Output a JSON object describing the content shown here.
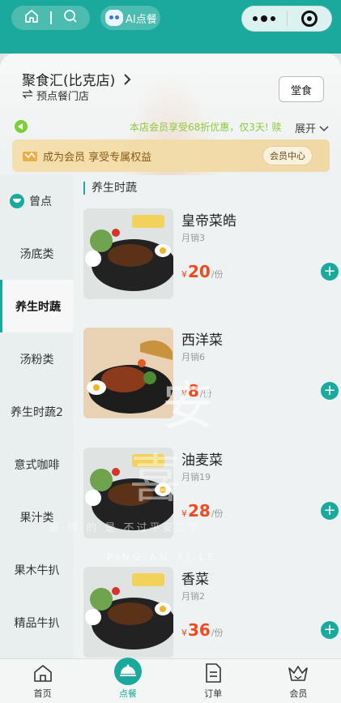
{
  "header": {
    "ai_label": "AI点餐"
  },
  "shop": {
    "name": "聚食汇(比克店)",
    "switch_label": "预点餐门店",
    "dine_label": "堂食",
    "notice": "本店会员享受68折优惠，仅3天! 赎",
    "expand_label": "展开",
    "member_text": "成为会员 享受专属权益",
    "member_button": "会员中心"
  },
  "sidebar": {
    "items": [
      {
        "label": "曾点"
      },
      {
        "label": "汤底类"
      },
      {
        "label": "养生时蔬"
      },
      {
        "label": "汤粉类"
      },
      {
        "label": "养生时蔬2"
      },
      {
        "label": "意式咖啡"
      },
      {
        "label": "果汁类"
      },
      {
        "label": "果木牛扒"
      },
      {
        "label": "精品牛扒"
      }
    ],
    "active_index": 2
  },
  "menu": {
    "section_title": "养生时蔬",
    "dishes": [
      {
        "name": "皇帝菜皓",
        "sales": "月销3",
        "currency": "¥",
        "price": "20",
        "unit": "/份"
      },
      {
        "name": "西洋菜",
        "sales": "月销6",
        "currency": "¥",
        "price": "8",
        "unit": "/份"
      },
      {
        "name": "油麦菜",
        "sales": "月销19",
        "currency": "¥",
        "price": "28",
        "unit": "/份"
      },
      {
        "name": "香菜",
        "sales": "月销2",
        "currency": "¥",
        "price": "36",
        "unit": "/份"
      }
    ]
  },
  "watermark": {
    "line1": "最 情 的 是 不过平安二字",
    "line2": "PING AN XI LE",
    "big_char_1": "安",
    "big_char_2": "喜"
  },
  "tabbar": {
    "items": [
      {
        "label": "首页",
        "icon": "home-icon"
      },
      {
        "label": "点餐",
        "icon": "order-food-icon"
      },
      {
        "label": "订单",
        "icon": "order-list-icon"
      },
      {
        "label": "会员",
        "icon": "member-crown-icon"
      }
    ],
    "active_index": 1
  },
  "colors": {
    "brand": "#1aa99c",
    "price": "#f04a21",
    "notice": "#8dc93c",
    "member_gold": "#f4dfae"
  }
}
